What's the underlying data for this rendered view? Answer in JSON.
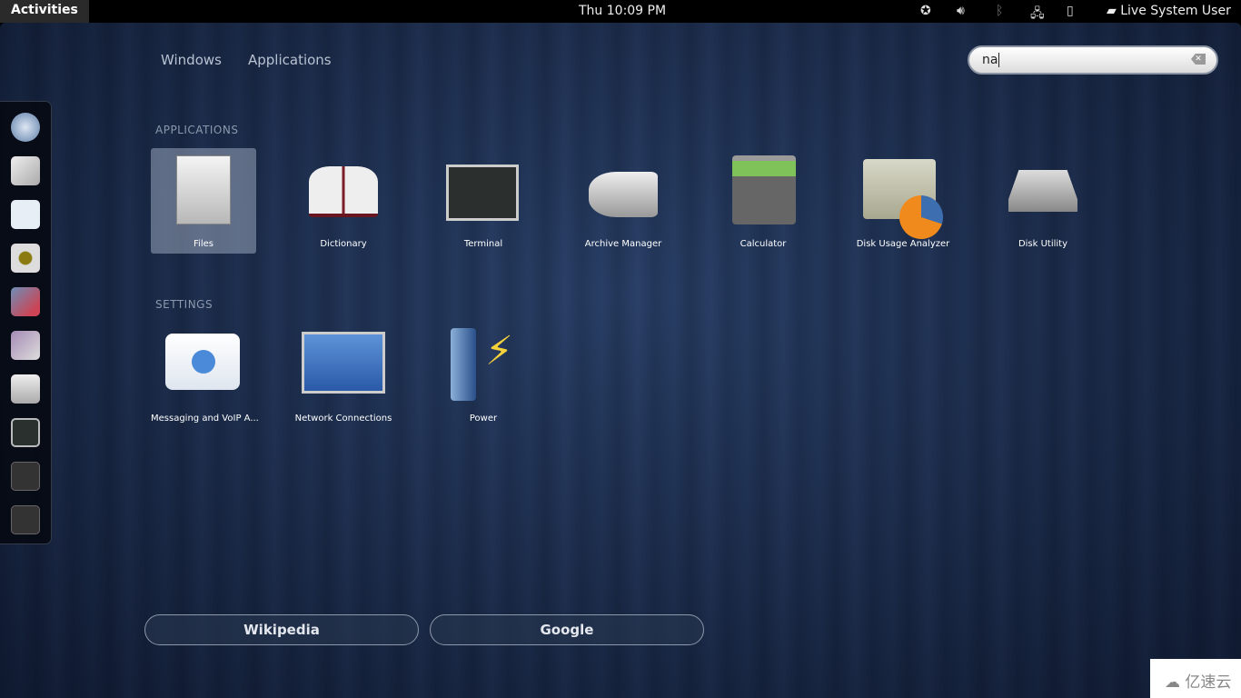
{
  "topbar": {
    "activities": "Activities",
    "clock": "Thu 10:09 PM",
    "user": "Live System User",
    "indicators": [
      "accessibility-icon",
      "volume-icon",
      "bluetooth-disabled-icon",
      "network-wired-icon",
      "battery-charging-icon"
    ]
  },
  "views": {
    "windows": "Windows",
    "applications": "Applications"
  },
  "search": {
    "value": "na"
  },
  "dash": {
    "items": [
      "web-browser",
      "mail-clock",
      "empathy-messaging",
      "rhythmbox-speaker",
      "image-viewer",
      "cheese-webcam",
      "files-cabinet",
      "terminal",
      "lock-safe",
      "lock-safe"
    ]
  },
  "sections": {
    "applications": "APPLICATIONS",
    "settings": "SETTINGS"
  },
  "applications": [
    {
      "label": "Files",
      "icon": "file-cabinet-icon",
      "selected": true
    },
    {
      "label": "Dictionary",
      "icon": "book-icon"
    },
    {
      "label": "Terminal",
      "icon": "terminal-icon"
    },
    {
      "label": "Archive Manager",
      "icon": "archive-roller-icon"
    },
    {
      "label": "Calculator",
      "icon": "calculator-icon"
    },
    {
      "label": "Disk Usage Analyzer",
      "icon": "disk-usage-icon"
    },
    {
      "label": "Disk Utility",
      "icon": "disk-utility-icon"
    }
  ],
  "settings": [
    {
      "label": "Messaging and VoIP A...",
      "icon": "chat-bubble-icon"
    },
    {
      "label": "Network Connections",
      "icon": "network-computers-icon"
    },
    {
      "label": "Power",
      "icon": "battery-power-icon"
    }
  ],
  "providers": {
    "wikipedia": "Wikipedia",
    "google": "Google"
  },
  "watermark": "亿速云"
}
